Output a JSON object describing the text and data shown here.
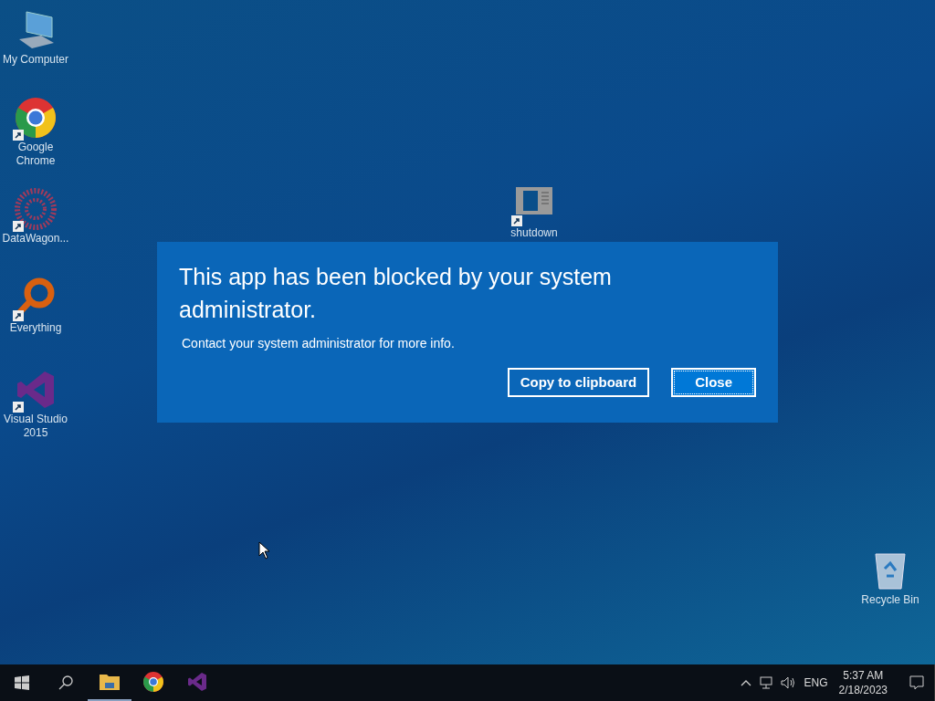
{
  "desktop_icons": [
    {
      "label": "My Computer",
      "kind": "computer",
      "shortcut": false
    },
    {
      "label": "Google Chrome",
      "kind": "chrome",
      "shortcut": true
    },
    {
      "label": "DataWagon...",
      "kind": "datawagon",
      "shortcut": true
    },
    {
      "label": "Everything",
      "kind": "everything",
      "shortcut": true
    },
    {
      "label": "Visual Studio 2015",
      "kind": "visualstudio",
      "shortcut": true
    },
    {
      "label": "shutdown",
      "kind": "shutdown",
      "shortcut": true
    },
    {
      "label": "Recycle Bin",
      "kind": "recycle",
      "shortcut": false
    }
  ],
  "dialog": {
    "title": "This app has been blocked by your system administrator.",
    "message": "Contact your system administrator for more info.",
    "buttons": [
      {
        "label": "Copy to clipboard",
        "focused": false
      },
      {
        "label": "Close",
        "focused": true
      }
    ]
  },
  "taskbar": {
    "apps": [
      {
        "kind": "explorer",
        "running": true
      },
      {
        "kind": "chrome",
        "running": false
      },
      {
        "kind": "visualstudio",
        "running": false
      }
    ],
    "tray": {
      "language": "ENG",
      "time": "5:37 AM",
      "date": "2/18/2023"
    }
  }
}
